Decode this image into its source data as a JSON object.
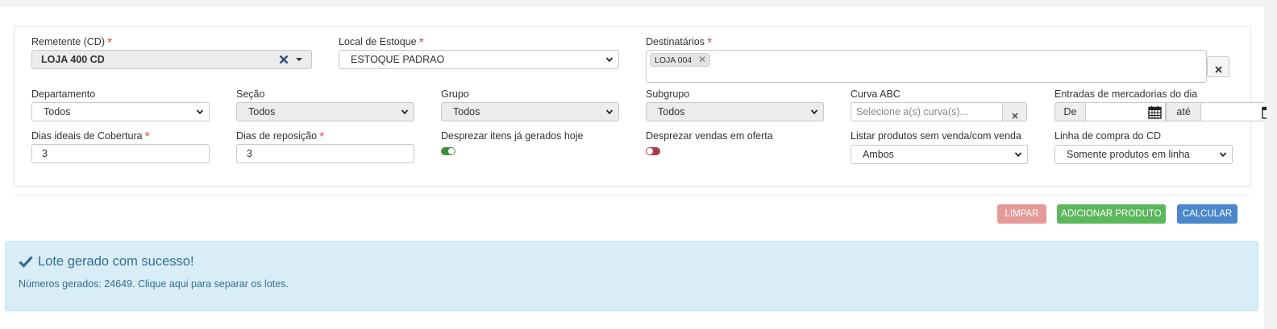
{
  "form": {
    "remetente": {
      "label": "Remetente (CD)",
      "value": "LOJA 400 CD"
    },
    "local_estoque": {
      "label": "Local de Estoque",
      "value": "ESTOQUE PADRAO"
    },
    "destinatarios": {
      "label": "Destinatários",
      "tags": [
        "LOJA 004"
      ]
    },
    "departamento": {
      "label": "Departamento",
      "value": "Todos"
    },
    "secao": {
      "label": "Seção",
      "value": "Todos"
    },
    "grupo": {
      "label": "Grupo",
      "value": "Todos"
    },
    "subgrupo": {
      "label": "Subgrupo",
      "value": "Todos"
    },
    "curva_abc": {
      "label": "Curva ABC",
      "placeholder": "Selecione a(s) curva(s)..."
    },
    "entradas": {
      "label": "Entradas de mercadorias do dia",
      "from_label": "De",
      "to_label": "até"
    },
    "dias_cobertura": {
      "label": "Dias ideais de Cobertura",
      "value": "3"
    },
    "dias_reposicao": {
      "label": "Dias de reposição",
      "value": "3"
    },
    "desprezar_itens": {
      "label": "Desprezar itens já gerados hoje",
      "checked": true
    },
    "desprezar_vendas": {
      "label": "Desprezar vendas em oferta",
      "checked": false
    },
    "listar_produtos": {
      "label": "Listar produtos sem venda/com venda",
      "value": "Ambos"
    },
    "linha_compra": {
      "label": "Linha de compra do CD",
      "value": "Somente produtos em linha"
    },
    "required_mark": "*"
  },
  "actions": {
    "limpar": "LIMPAR",
    "adicionar": "ADICIONAR PRODUTO",
    "calcular": "CALCULAR"
  },
  "alert": {
    "title": "Lote gerado com sucesso!",
    "message": "Números gerados: 24649. Clique aqui para separar os lotes."
  },
  "colors": {
    "required": "#d9534f",
    "toggle_on": "#3c8d3c",
    "toggle_off": "#b03a48",
    "btn_limpar": "#e59a98",
    "btn_adicionar": "#5cb85c",
    "btn_calcular": "#4a88c9",
    "alert_text": "#31708f"
  }
}
